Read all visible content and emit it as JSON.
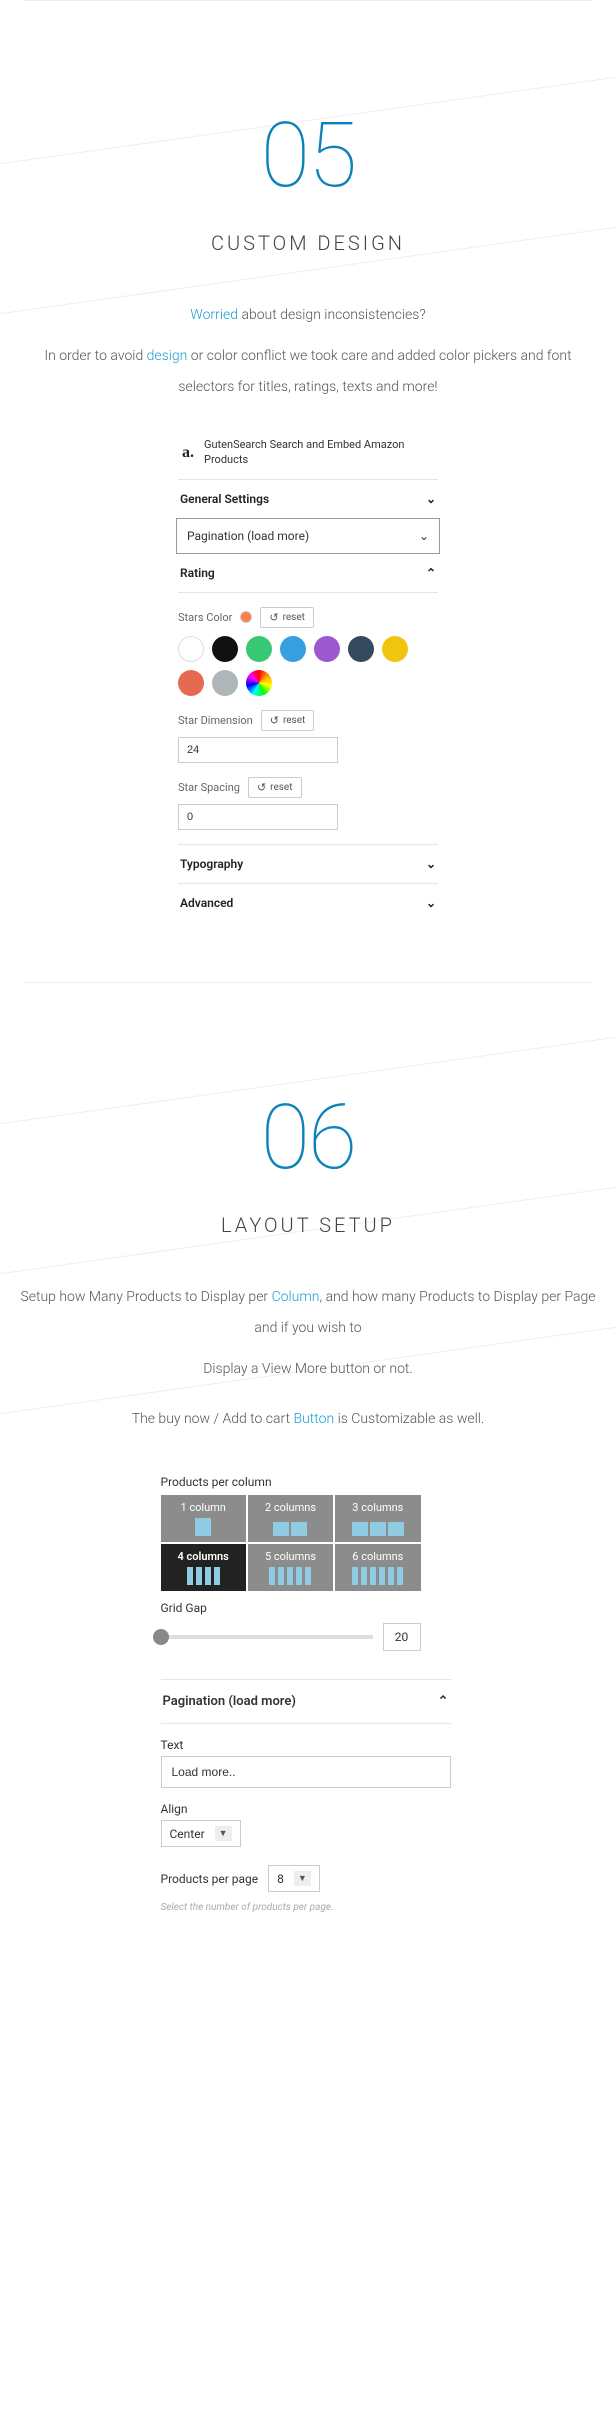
{
  "section05": {
    "number": "05",
    "title": "CUSTOM DESIGN",
    "p1a": "Worried",
    "p1b": " about design inconsistencies?",
    "p2a": "In order to avoid ",
    "p2b": "design",
    "p2c": " or color conflict we took care and added color pickers and font selectors for titles, ratings, texts and more!"
  },
  "panel05": {
    "icon_label": "a.",
    "header_text": "GutenSearch Search and Embed Amazon Products",
    "general": "General Settings",
    "pagination": "Pagination (load more)",
    "rating_title": "Rating",
    "stars_color": "Stars Color",
    "reset": "reset",
    "swatches": [
      {
        "bg": "#ffffff",
        "outline": true
      },
      {
        "bg": "#111111"
      },
      {
        "bg": "#38c873"
      },
      {
        "bg": "#359fe2"
      },
      {
        "bg": "#9b59d0"
      },
      {
        "bg": "#34495e"
      },
      {
        "bg": "#f1c40f"
      },
      {
        "bg": "#e66a52"
      },
      {
        "bg": "#aeb6b9"
      },
      {
        "rainbow": true
      }
    ],
    "star_dimension": "Star Dimension",
    "star_dimension_value": "24",
    "star_spacing": "Star Spacing",
    "star_spacing_value": "0",
    "typography": "Typography",
    "advanced": "Advanced"
  },
  "section06": {
    "number": "06",
    "title": "LAYOUT SETUP",
    "p1a": "Setup how Many Products to Display per ",
    "p1b": "Column",
    "p1c": ", and how many Products to Display per Page and if you wish to",
    "p2": "Display a View More button  or not.",
    "p3a": "The buy now / Add to cart ",
    "p3b": "Button",
    "p3c": " is Customizable as well."
  },
  "panel06": {
    "ppc": "Products per column",
    "cols": [
      "1 column",
      "2 columns",
      "3 columns",
      "4 columns",
      "5 columns",
      "6 columns"
    ],
    "selected_col": 3,
    "grid_gap": "Grid Gap",
    "grid_gap_value": "20",
    "pagination": "Pagination (load more)",
    "text_label": "Text",
    "text_value": "Load more..",
    "align_label": "Align",
    "align_value": "Center",
    "ppp_label": "Products per page",
    "ppp_value": "8",
    "help": "Select the number of products per page."
  }
}
